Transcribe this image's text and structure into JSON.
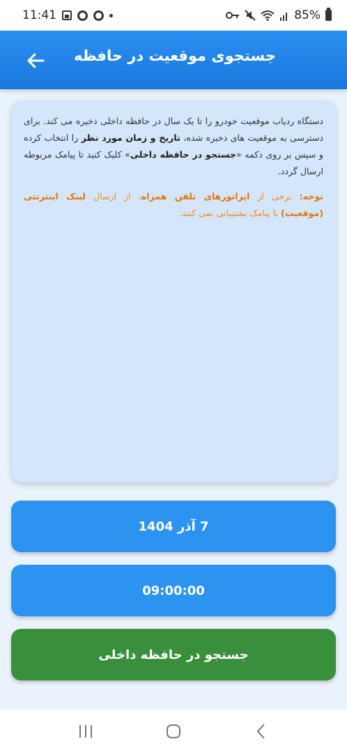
{
  "status_bar": {
    "time": "11:41",
    "battery": "85%"
  },
  "app_bar": {
    "title": "جستجوی موقعیت در حافظه"
  },
  "info": {
    "p1_a": "دستگاه ردیاب موقعیت خودرو را تا یک سال در حافظه داخلی ذخیره می کند. برای دسترسی به موقعیت های ذخیره شده، ",
    "p1_b": "تاریخ و زمان مورد نظر",
    "p1_c": " را انتخاب کرده و سپس بر روی دکمه «",
    "p1_d": "جستجو در حافظه داخلی",
    "p1_e": "» کلیک کنید تا پیامک مربوطه ارسال گردد.",
    "note_a": "توجه:",
    "note_b": " برخی از ",
    "note_c": "اپراتورهای تلفن همراه",
    "note_d": "، از ارسال ",
    "note_e": "لینک اینترنتی (موقعیت)",
    "note_f": " با پیامک پشتیبانی نمی کنند."
  },
  "buttons": {
    "date": "7 آذر 1404",
    "time": "09:00:00",
    "search": "جستجو در حافظه داخلی"
  },
  "colors": {
    "app_bar": "#1a78de",
    "card_bg": "#d4e6fb",
    "primary_button": "#2c94f0",
    "search_button": "#3a8f3c",
    "note_text": "#f08a1c"
  },
  "icons": {
    "back": "arrow-left-icon",
    "nav_recents": "recents-icon",
    "nav_home": "home-icon",
    "nav_back": "chevron-left-icon"
  }
}
